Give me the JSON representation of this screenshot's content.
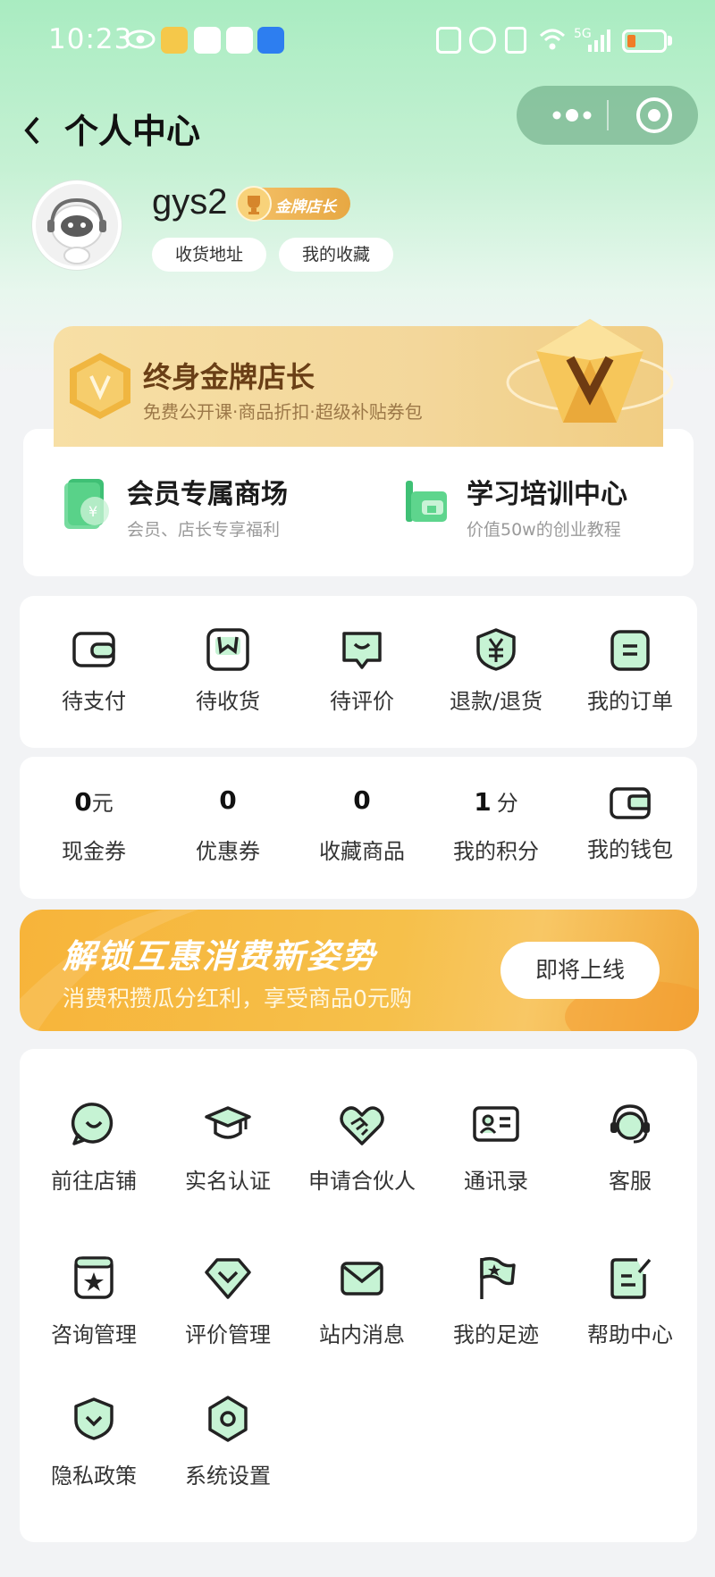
{
  "status_bar": {
    "time": "10:23",
    "network": "5G"
  },
  "header": {
    "back_icon": "chevron-left-icon",
    "title": "个人中心"
  },
  "profile": {
    "username": "gys2",
    "badge": "金牌店长",
    "links": [
      "收货地址",
      "我的收藏"
    ]
  },
  "gold_banner": {
    "title": "终身金牌店长",
    "subtitle": "免费公开课·商品折扣·超级补贴券包"
  },
  "mall_entries": [
    {
      "title": "会员专属商场",
      "subtitle": "会员、店长专享福利",
      "icon": "coupon-icon"
    },
    {
      "title": "学习培训中心",
      "subtitle": "价值50w的创业教程",
      "icon": "training-icon"
    }
  ],
  "orders": [
    {
      "label": "待支付",
      "icon": "wallet-icon"
    },
    {
      "label": "待收货",
      "icon": "package-icon"
    },
    {
      "label": "待评价",
      "icon": "comment-icon"
    },
    {
      "label": "退款/退货",
      "icon": "refund-icon"
    },
    {
      "label": "我的订单",
      "icon": "order-list-icon"
    }
  ],
  "assets": [
    {
      "value": "0",
      "unit": "元",
      "label": "现金券"
    },
    {
      "value": "0",
      "unit": "",
      "label": "优惠券"
    },
    {
      "value": "0",
      "unit": "",
      "label": "收藏商品"
    },
    {
      "value": "1",
      "unit": "分",
      "label": "我的积分"
    },
    {
      "value": "",
      "unit": "",
      "label": "我的钱包",
      "icon": "wallet-icon"
    }
  ],
  "promo": {
    "title": "解锁互惠消费新姿势",
    "subtitle": "消费积攒瓜分红利，享受商品0元购",
    "button": "即将上线"
  },
  "services": [
    {
      "label": "前往店铺",
      "icon": "store-smile-icon"
    },
    {
      "label": "实名认证",
      "icon": "graduation-cap-icon"
    },
    {
      "label": "申请合伙人",
      "icon": "handshake-heart-icon"
    },
    {
      "label": "通讯录",
      "icon": "contact-card-icon"
    },
    {
      "label": "客服",
      "icon": "headset-icon"
    },
    {
      "label": "咨询管理",
      "icon": "star-folder-icon"
    },
    {
      "label": "评价管理",
      "icon": "rating-diamond-icon"
    },
    {
      "label": "站内消息",
      "icon": "mail-icon"
    },
    {
      "label": "我的足迹",
      "icon": "flag-icon"
    },
    {
      "label": "帮助中心",
      "icon": "edit-doc-icon"
    },
    {
      "label": "隐私政策",
      "icon": "shield-icon"
    },
    {
      "label": "系统设置",
      "icon": "settings-hex-icon"
    }
  ],
  "colors": {
    "accent_green": "#7ee0a0",
    "gold_text": "#6a3f16",
    "promo_orange": "#f6b73f"
  }
}
